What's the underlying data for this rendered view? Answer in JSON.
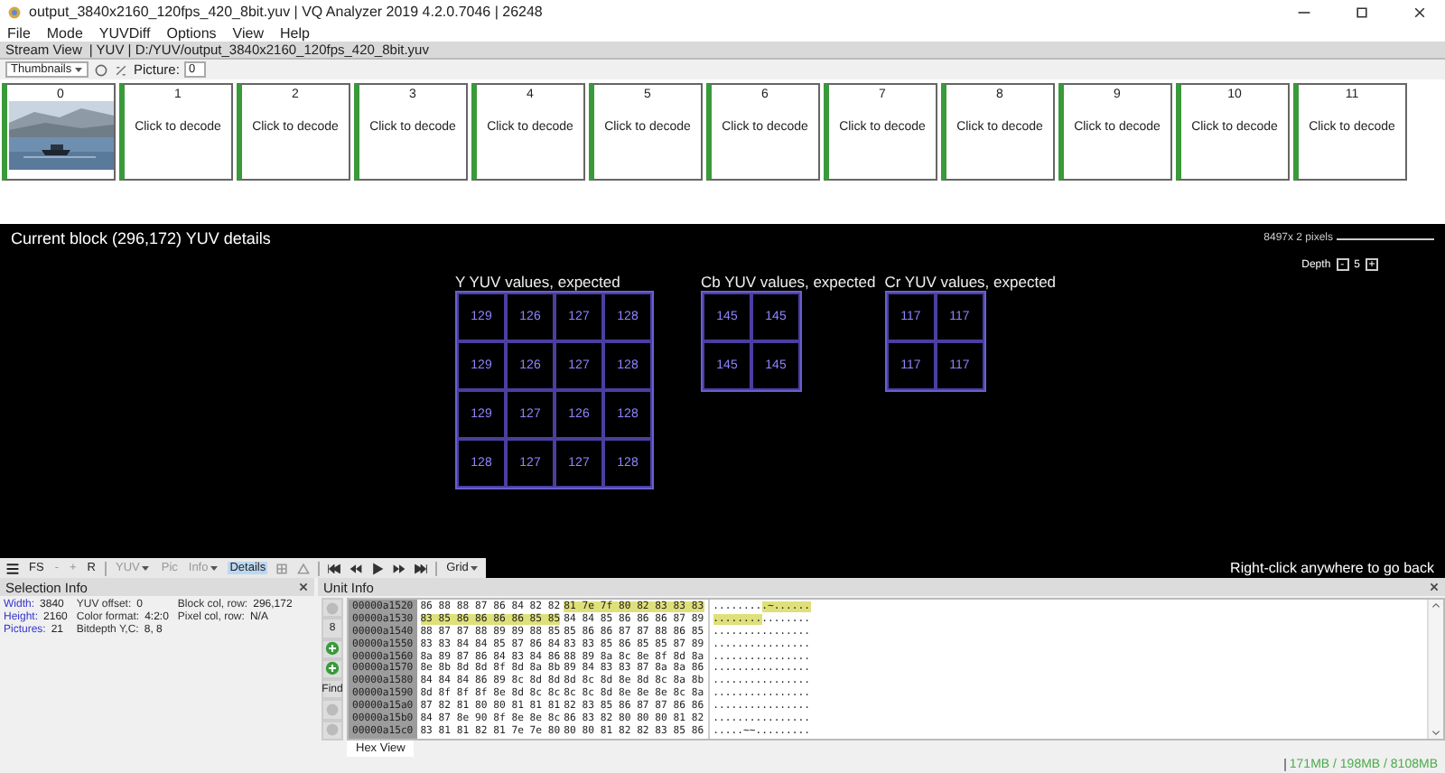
{
  "window": {
    "title": "output_3840x2160_120fps_420_8bit.yuv | VQ Analyzer 2019 4.2.0.7046  | 26248"
  },
  "menu": [
    "File",
    "Mode",
    "YUVDiff",
    "Options",
    "View",
    "Help"
  ],
  "stream_bar": {
    "title": "Stream View",
    "path": "| YUV | D:/YUV/output_3840x2160_120fps_420_8bit.yuv"
  },
  "toolbar": {
    "view": "Thumbnails",
    "picture_label": "Picture:",
    "picture": "0"
  },
  "thumbnails": [
    {
      "index": "0",
      "kind": "picture"
    },
    {
      "index": "1",
      "kind": "pending",
      "label": "Click to decode"
    },
    {
      "index": "2",
      "kind": "pending",
      "label": "Click to decode"
    },
    {
      "index": "3",
      "kind": "pending",
      "label": "Click to decode"
    },
    {
      "index": "4",
      "kind": "pending",
      "label": "Click to decode"
    },
    {
      "index": "5",
      "kind": "pending",
      "label": "Click to decode"
    },
    {
      "index": "6",
      "kind": "pending",
      "label": "Click to decode"
    },
    {
      "index": "7",
      "kind": "pending",
      "label": "Click to decode"
    },
    {
      "index": "8",
      "kind": "pending",
      "label": "Click to decode"
    },
    {
      "index": "9",
      "kind": "pending",
      "label": "Click to decode"
    },
    {
      "index": "10",
      "kind": "pending",
      "label": "Click to decode"
    },
    {
      "index": "11",
      "kind": "pending",
      "label": "Click to decode"
    }
  ],
  "details": {
    "title": "Current block (296,172) YUV details",
    "zoom_label": "8497x 2 pixels",
    "zoom": {
      "level": 1
    },
    "depth_label": "Depth",
    "depth_minus": "-",
    "depth": "5",
    "depth_plus": "+",
    "planes": [
      {
        "title": "Y YUV values, expected",
        "rows": [
          [
            "129",
            "126",
            "127",
            "128"
          ],
          [
            "129",
            "126",
            "127",
            "128"
          ],
          [
            "129",
            "127",
            "126",
            "128"
          ],
          [
            "128",
            "127",
            "127",
            "128"
          ]
        ]
      },
      {
        "title": "Cb YUV values, expected",
        "rows": [
          [
            "145",
            "145"
          ],
          [
            "145",
            "145"
          ]
        ]
      },
      {
        "title": "Cr YUV values, expected",
        "rows": [
          [
            "117",
            "117"
          ],
          [
            "117",
            "117"
          ]
        ]
      }
    ],
    "hint": "Right-click anywhere to go back"
  },
  "view_toolbar": [
    {
      "kind": "menu"
    },
    {
      "kind": "text",
      "label": "FS",
      "disabled": false,
      "selected": false
    },
    {
      "kind": "text",
      "label": "-",
      "disabled": true,
      "selected": false
    },
    {
      "kind": "text",
      "label": "+",
      "disabled": true,
      "selected": false
    },
    {
      "kind": "text",
      "label": "R",
      "disabled": false,
      "selected": false
    },
    {
      "kind": "sep"
    },
    {
      "kind": "drop",
      "label": "YUV",
      "disabled": true,
      "selected": false
    },
    {
      "kind": "text",
      "label": "Pic",
      "disabled": true,
      "selected": false
    },
    {
      "kind": "drop",
      "label": "Info",
      "disabled": true,
      "selected": false
    },
    {
      "kind": "text",
      "label": "Details",
      "disabled": false,
      "selected": true
    },
    {
      "kind": "grid"
    },
    {
      "kind": "delta"
    },
    {
      "kind": "sep"
    },
    {
      "kind": "first"
    },
    {
      "kind": "prev"
    },
    {
      "kind": "play"
    },
    {
      "kind": "next"
    },
    {
      "kind": "last"
    },
    {
      "kind": "sep"
    },
    {
      "kind": "drop",
      "label": "Grid",
      "disabled": false,
      "selected": false
    }
  ],
  "selection_info": {
    "title": "Selection Info",
    "columns": [
      [
        {
          "label": "Width:",
          "value": "3840"
        },
        {
          "label": "Height:",
          "value": "2160"
        },
        {
          "label": "Pictures:",
          "value": "21"
        }
      ],
      [
        {
          "label": "YUV offset:",
          "value": "0"
        },
        {
          "label": "Color format:",
          "value": "4:2:0"
        },
        {
          "label": "Bitdepth Y,C:",
          "value": "8, 8"
        }
      ],
      [
        {
          "label": "Block col, row:",
          "value": "296,172"
        },
        {
          "label": "Pixel col, row:",
          "value": "N/A"
        }
      ]
    ]
  },
  "unit_info": {
    "title": "Unit Info",
    "side_buttons": [
      {
        "kind": "icon"
      },
      {
        "kind": "text",
        "label": "8"
      },
      {
        "kind": "add"
      },
      {
        "kind": "add"
      },
      {
        "kind": "text",
        "label": "Find"
      },
      {
        "kind": "icon"
      },
      {
        "kind": "icon"
      }
    ],
    "rows": [
      {
        "address": "00000a1520",
        "hex_a": "86 88 88 87 86 84 82 82",
        "hex_b": "81 7e 7f 80 82 83 83 83",
        "ascii_a": "........",
        "ascii_b": ".~......",
        "highlight_a": false,
        "highlight_b": true
      },
      {
        "address": "00000a1530",
        "hex_a": "83 85 86 86 86 86 85 85",
        "hex_b": "84 84 85 86 86 86 87 89",
        "ascii_a": "........",
        "ascii_b": "........",
        "highlight_a": true,
        "highlight_b": false
      },
      {
        "address": "00000a1540",
        "hex_a": "88 87 87 88 89 89 88 85",
        "hex_b": "85 86 86 87 87 88 86 85",
        "ascii_a": "........",
        "ascii_b": "........",
        "highlight_a": false,
        "highlight_b": false
      },
      {
        "address": "00000a1550",
        "hex_a": "83 83 84 84 85 87 86 84",
        "hex_b": "83 83 85 86 85 85 87 89",
        "ascii_a": "........",
        "ascii_b": "........",
        "highlight_a": false,
        "highlight_b": false
      },
      {
        "address": "00000a1560",
        "hex_a": "8a 89 87 86 84 83 84 86",
        "hex_b": "88 89 8a 8c 8e 8f 8d 8a",
        "ascii_a": "........",
        "ascii_b": "........",
        "highlight_a": false,
        "highlight_b": false
      },
      {
        "address": "00000a1570",
        "hex_a": "8e 8b 8d 8d 8f 8d 8a 8b",
        "hex_b": "89 84 83 83 87 8a 8a 86",
        "ascii_a": "........",
        "ascii_b": "........",
        "highlight_a": false,
        "highlight_b": false
      },
      {
        "address": "00000a1580",
        "hex_a": "84 84 84 86 89 8c 8d 8d",
        "hex_b": "8d 8c 8d 8e 8d 8c 8a 8b",
        "ascii_a": "........",
        "ascii_b": "........",
        "highlight_a": false,
        "highlight_b": false
      },
      {
        "address": "00000a1590",
        "hex_a": "8d 8f 8f 8f 8e 8d 8c 8c",
        "hex_b": "8c 8c 8d 8e 8e 8e 8c 8a",
        "ascii_a": "........",
        "ascii_b": "........",
        "highlight_a": false,
        "highlight_b": false
      },
      {
        "address": "00000a15a0",
        "hex_a": "87 82 81 80 80 81 81 81",
        "hex_b": "82 83 85 86 87 87 86 86",
        "ascii_a": "........",
        "ascii_b": "........",
        "highlight_a": false,
        "highlight_b": false
      },
      {
        "address": "00000a15b0",
        "hex_a": "84 87 8e 90 8f 8e 8e 8c",
        "hex_b": "86 83 82 80 80 80 81 82",
        "ascii_a": "........",
        "ascii_b": "........",
        "highlight_a": false,
        "highlight_b": false
      },
      {
        "address": "00000a15c0",
        "hex_a": "83 81 81 82 81 7e 7e 80",
        "hex_b": "80 80 81 82 82 83 85 86",
        "ascii_a": ".....~~.",
        "ascii_b": "........",
        "highlight_a": false,
        "highlight_b": false
      }
    ],
    "tab": "Hex View"
  },
  "status": "171MB / 198MB / 8108MB"
}
